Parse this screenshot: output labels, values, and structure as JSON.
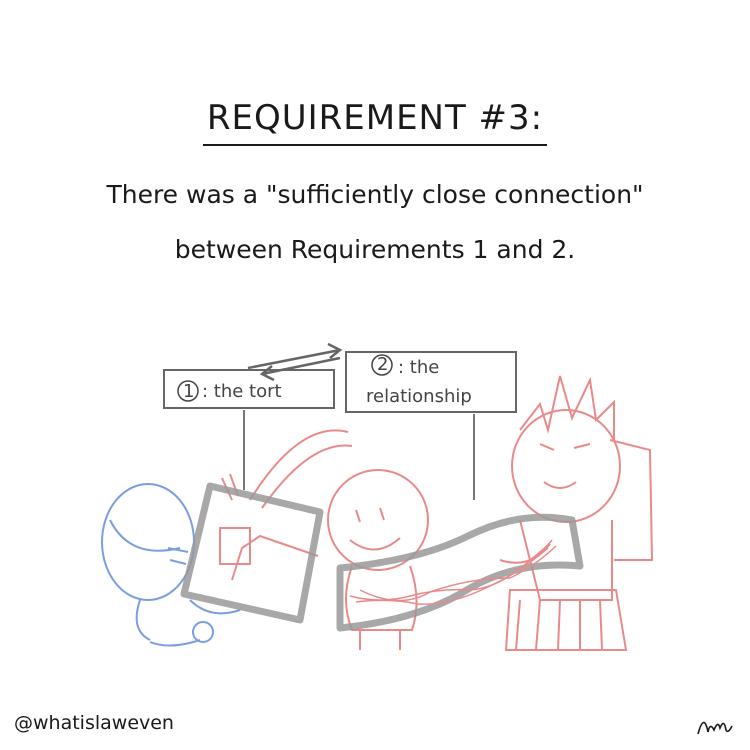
{
  "title": "REQUIREMENT #3:",
  "statement": {
    "line1": "There was a \"sufficiently close connection\"",
    "line2": "between Requirements 1 and 2."
  },
  "labels": {
    "tort": {
      "number": "1",
      "text": ": the tort"
    },
    "relationship": {
      "number": "2",
      "text1": ": the",
      "text2": "relationship"
    }
  },
  "handle": "@whatislaweven",
  "colors": {
    "ink": "#1a1a1a",
    "gray": "#8a8a8a",
    "red_figures": "#e88a8a",
    "blue_figure": "#7a9fe0"
  }
}
